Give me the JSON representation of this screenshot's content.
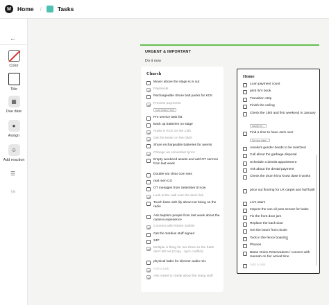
{
  "topbar": {
    "logo": "M",
    "home": "Home",
    "separator": "/",
    "tasks": "Tasks"
  },
  "sidebar": {
    "back": "←",
    "buttons": [
      {
        "label": "Color"
      },
      {
        "label": "Title"
      },
      {
        "label": "Due date"
      },
      {
        "label": "Assign"
      },
      {
        "label": "Add reaction"
      }
    ],
    "list_icon": "☰",
    "list_icon2": "⁝≡"
  },
  "group": {
    "title": "URGENT & IMPORTANT",
    "subtitle": "Do it now",
    "accent": "#63bf4e"
  },
  "church": {
    "title": "Church",
    "items": [
      {
        "text": "Mover above the stage is is out",
        "done": false
      },
      {
        "text": "Payments",
        "done": true
      },
      {
        "text": "Rechargeable Shure batt packs for KCK",
        "done": false
      },
      {
        "text": "Process payments",
        "done": true,
        "tag": "Due today (Thur)"
      },
      {
        "text": "Pre service task list",
        "done": false
      },
      {
        "text": "Back up batteries on stage",
        "done": false
      },
      {
        "text": "Audio in KCK on the 13th",
        "done": true
      },
      {
        "text": "Get the tester on the DMX",
        "done": true
      },
      {
        "text": "Shure rechargeable batteries for avents",
        "done": false
      },
      {
        "text": "Change we remember lyrics",
        "done": true
      },
      {
        "text": "Empty weekend assets and add OT sermon from last week",
        "done": false
      },
      {
        "text": "Double ear clear com sets",
        "done": false
      },
      {
        "text": "real men CG",
        "done": false
      },
      {
        "text": "OT mesages from Setember til now",
        "done": false
      },
      {
        "text": "Look at the wall over the deck link",
        "done": true
      },
      {
        "text": "Touch base with lily about not being on the radio",
        "done": false
      },
      {
        "text": "Ask baptism people from last week about the camera experience",
        "done": false
      },
      {
        "text": "Connect with Robert Stablin",
        "done": true
      },
      {
        "text": "Get the Sardius stuff signed",
        "done": false
      },
      {
        "text": "24P",
        "done": false
      },
      {
        "text": "Multiple ci thing for mix three so the batts don't fall out (Copy - sync conflict)",
        "done": true
      },
      {
        "text": "physical fader for director audio mix",
        "done": false
      },
      {
        "text": "Add a task",
        "done": true,
        "faint": true
      },
      {
        "text": "Ask russel to clarify about the slang stuff",
        "done": true
      }
    ]
  },
  "home": {
    "title": "Home",
    "items": [
      {
        "text": "Loan payment count",
        "done": false
      },
      {
        "text": "print liv's book",
        "done": false
      },
      {
        "text": "Transition strip",
        "done": false
      },
      {
        "text": "Finish the ceiling",
        "done": false
      },
      {
        "text": "Check the 15th and first weekend in January",
        "done": false,
        "tag": "Assign to..."
      },
      {
        "text": "Find a time to have Jack over",
        "done": false,
        "tag": "Set due date..."
      },
      {
        "text": "Amelia's gender heeds to be switched",
        "done": false
      },
      {
        "text": "Call about the garbage disposal",
        "done": false
      },
      {
        "text": "Schedule a dentist appointment",
        "done": false
      },
      {
        "text": "Ask about the dental payment",
        "done": false
      },
      {
        "text": "Check the drum kit to know dase it works",
        "done": false
      },
      {
        "text": "price out flooring for LR carpet and half bath",
        "done": false
      },
      {
        "text": "Liv's stairs",
        "done": false
      },
      {
        "text": "Inspect the van oil pres sensor for leaks",
        "done": false
      },
      {
        "text": "Fix the front door jam",
        "done": false
      },
      {
        "text": "Replace the back door",
        "done": false
      },
      {
        "text": "Get the boom from nicole",
        "done": false
      },
      {
        "text": "Tack in the fence boards",
        "done": false,
        "cursor": true
      },
      {
        "text": "Phones",
        "done": false
      },
      {
        "text": "Brass Onion Reservations / connect with Hannah on her arrival time",
        "done": false
      },
      {
        "text": "Add a task",
        "done": false,
        "faint": true
      }
    ]
  }
}
